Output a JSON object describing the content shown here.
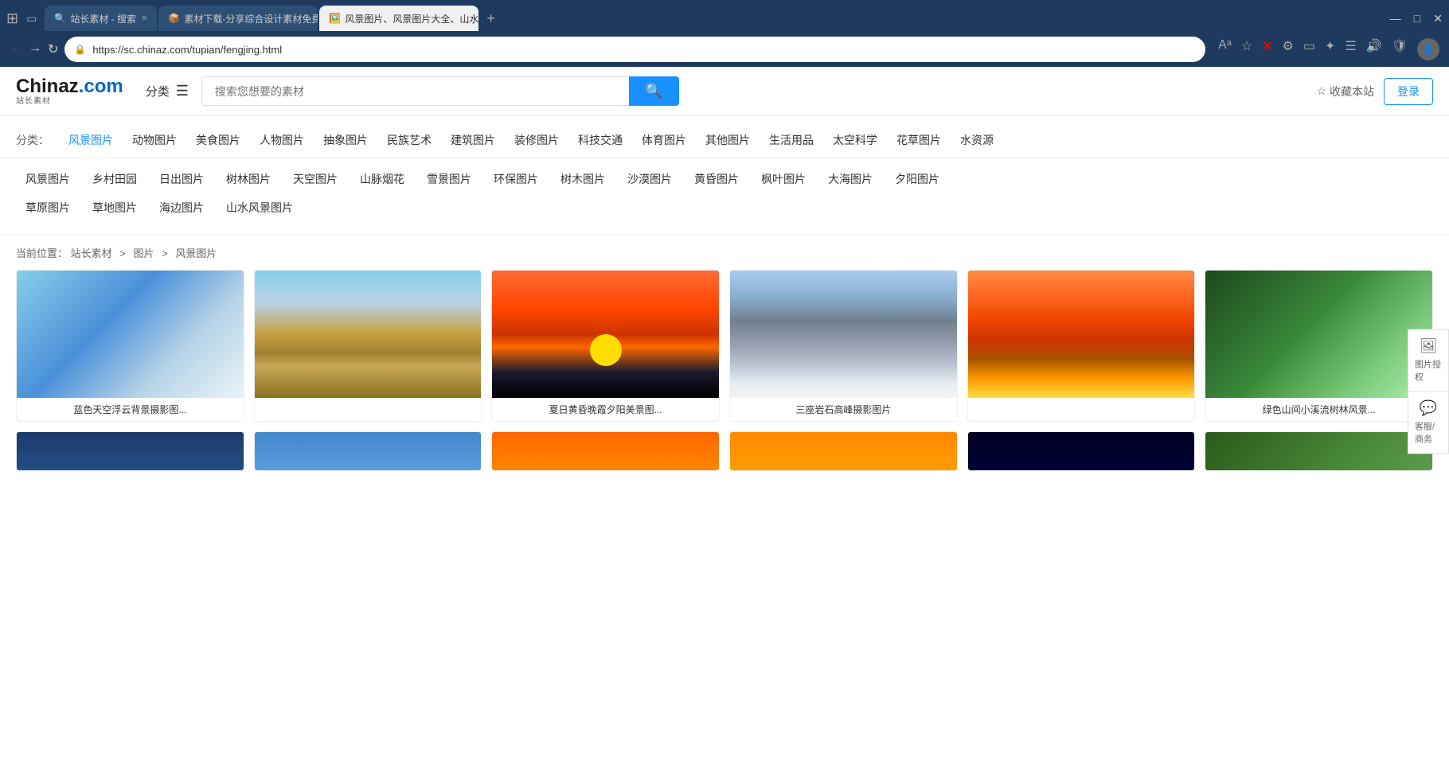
{
  "browser": {
    "tabs": [
      {
        "id": "tab1",
        "label": "站长素材 - 搜索",
        "favicon": "🔍",
        "active": false
      },
      {
        "id": "tab2",
        "label": "素材下载-分享综合设计素材免费...",
        "favicon": "📦",
        "active": false
      },
      {
        "id": "tab3",
        "label": "风景图片、风景图片大全、山水...",
        "favicon": "🖼️",
        "active": true
      }
    ],
    "address": "https://sc.chinaz.com/tupian/fengjing.html",
    "new_tab_label": "+",
    "window_controls": [
      "—",
      "□",
      "✕"
    ]
  },
  "header": {
    "logo_text": "ChinaZ",
    "logo_dot": ".",
    "logo_com": "com",
    "logo_sub": "站长素材",
    "nav_classify": "分类",
    "search_placeholder": "搜索您想要的素材",
    "search_btn_icon": "🔍",
    "bookmark_label": "收藏本站",
    "login_label": "登录"
  },
  "categories_main": {
    "label": "分类：",
    "items": [
      {
        "id": "fengjing",
        "label": "风景图片",
        "active": true
      },
      {
        "id": "dongwu",
        "label": "动物图片",
        "active": false
      },
      {
        "id": "meishi",
        "label": "美食图片",
        "active": false
      },
      {
        "id": "renwen",
        "label": "人物图片",
        "active": false
      },
      {
        "id": "chouxiang",
        "label": "抽象图片",
        "active": false
      },
      {
        "id": "minzu",
        "label": "民族艺术",
        "active": false
      },
      {
        "id": "jianzhu",
        "label": "建筑图片",
        "active": false
      },
      {
        "id": "zhuangxiu",
        "label": "装修图片",
        "active": false
      },
      {
        "id": "keji",
        "label": "科技交通",
        "active": false
      },
      {
        "id": "tiyu",
        "label": "体育图片",
        "active": false
      },
      {
        "id": "qita",
        "label": "其他图片",
        "active": false
      },
      {
        "id": "shenghuo",
        "label": "生活用品",
        "active": false
      },
      {
        "id": "taikong",
        "label": "太空科学",
        "active": false
      },
      {
        "id": "huacao",
        "label": "花草图片",
        "active": false
      },
      {
        "id": "shuiziyuan",
        "label": "水资源",
        "active": false
      }
    ]
  },
  "categories_sub": {
    "row1": [
      {
        "label": "风景图片"
      },
      {
        "label": "乡村田园"
      },
      {
        "label": "日出图片"
      },
      {
        "label": "树林图片"
      },
      {
        "label": "天空图片"
      },
      {
        "label": "山脉烟花"
      },
      {
        "label": "雪景图片"
      },
      {
        "label": "环保图片"
      },
      {
        "label": "树木图片"
      },
      {
        "label": "沙漠图片"
      },
      {
        "label": "黄昏图片"
      },
      {
        "label": "枫叶图片"
      },
      {
        "label": "大海图片"
      },
      {
        "label": "夕阳图片"
      }
    ],
    "row2": [
      {
        "label": "草原图片"
      },
      {
        "label": "草地图片"
      },
      {
        "label": "海边图片"
      },
      {
        "label": "山水风景图片"
      }
    ]
  },
  "breadcrumb": {
    "text": "当前位置：",
    "items": [
      "站长素材",
      "图片",
      "风景图片"
    ],
    "separators": [
      ">",
      ">"
    ]
  },
  "sidebar_btns": [
    {
      "icon": "🖼",
      "label": "图片授权"
    },
    {
      "icon": "💬",
      "label": "客服/商务"
    }
  ],
  "images": [
    {
      "id": 1,
      "caption": "蓝色天空浮云背景摄影图...",
      "cls": "img-1"
    },
    {
      "id": 2,
      "caption": "",
      "cls": "img-2"
    },
    {
      "id": 3,
      "caption": "夏日黄昏晚霞夕阳美景图...",
      "cls": "img-3"
    },
    {
      "id": 4,
      "caption": "三座岩石高峰摄影图片",
      "cls": "img-4"
    },
    {
      "id": 5,
      "caption": "",
      "cls": "img-5"
    },
    {
      "id": 6,
      "caption": "绿色山间小溪流树林风景...",
      "cls": "img-6"
    },
    {
      "id": 7,
      "caption": "",
      "cls": "img-7"
    },
    {
      "id": 8,
      "caption": "",
      "cls": "img-8"
    },
    {
      "id": 9,
      "caption": "",
      "cls": "img-9"
    },
    {
      "id": 10,
      "caption": "",
      "cls": "img-10"
    },
    {
      "id": 11,
      "caption": "",
      "cls": "img-11"
    },
    {
      "id": 12,
      "caption": "",
      "cls": "img-12"
    }
  ]
}
